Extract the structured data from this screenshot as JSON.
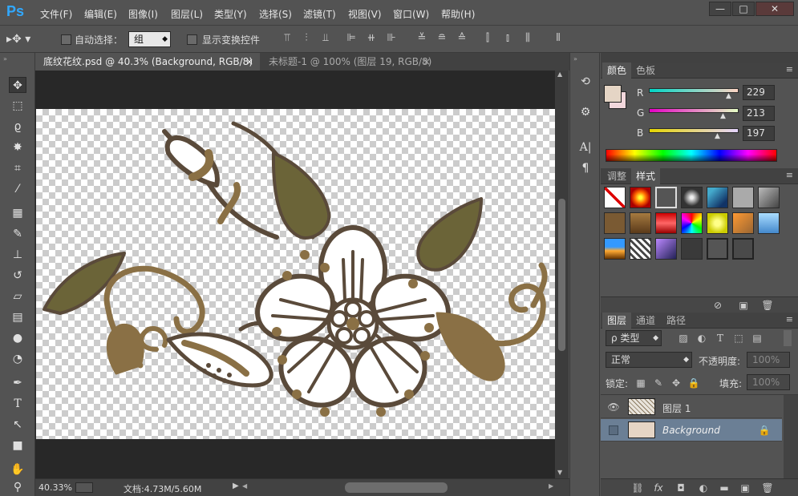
{
  "app": {
    "logo": "Ps"
  },
  "menu": [
    "文件(F)",
    "编辑(E)",
    "图像(I)",
    "图层(L)",
    "类型(Y)",
    "选择(S)",
    "滤镜(T)",
    "视图(V)",
    "窗口(W)",
    "帮助(H)"
  ],
  "window_controls": {
    "minimize": "—",
    "maximize": "□",
    "close": "✕"
  },
  "options_bar": {
    "auto_select_label": "自动选择：",
    "auto_select_value": "组",
    "show_transform_label": "显示变换控件"
  },
  "tabs": [
    {
      "title": "底纹花纹.psd @ 40.3% (Background, RGB/8) *",
      "close": "×",
      "active": true
    },
    {
      "title": "未标题-1 @ 100% (图层 19, RGB/8) *",
      "close": "×",
      "active": false
    }
  ],
  "status": {
    "zoom": "40.33%",
    "doc_label": "文档:4.73M/5.60M"
  },
  "color_panel": {
    "tabs": [
      "颜色",
      "色板"
    ],
    "foreground": "#e5d5c5",
    "background": "#f2d7dc",
    "channels": [
      {
        "label": "R",
        "value": "229"
      },
      {
        "label": "G",
        "value": "213"
      },
      {
        "label": "B",
        "value": "197"
      }
    ]
  },
  "styles_panel": {
    "tabs": [
      "调整",
      "样式"
    ]
  },
  "layers_panel": {
    "tabs": [
      "图层",
      "通道",
      "路径"
    ],
    "filter_label": "ρ 类型",
    "blend_mode": "正常",
    "opacity_label": "不透明度:",
    "opacity_value": "100%",
    "lock_label": "锁定:",
    "fill_label": "填充:",
    "fill_value": "100%",
    "layers": [
      {
        "name": "图层 1",
        "visible": true,
        "selected": false
      },
      {
        "name": "Background",
        "visible": false,
        "selected": true
      }
    ]
  }
}
